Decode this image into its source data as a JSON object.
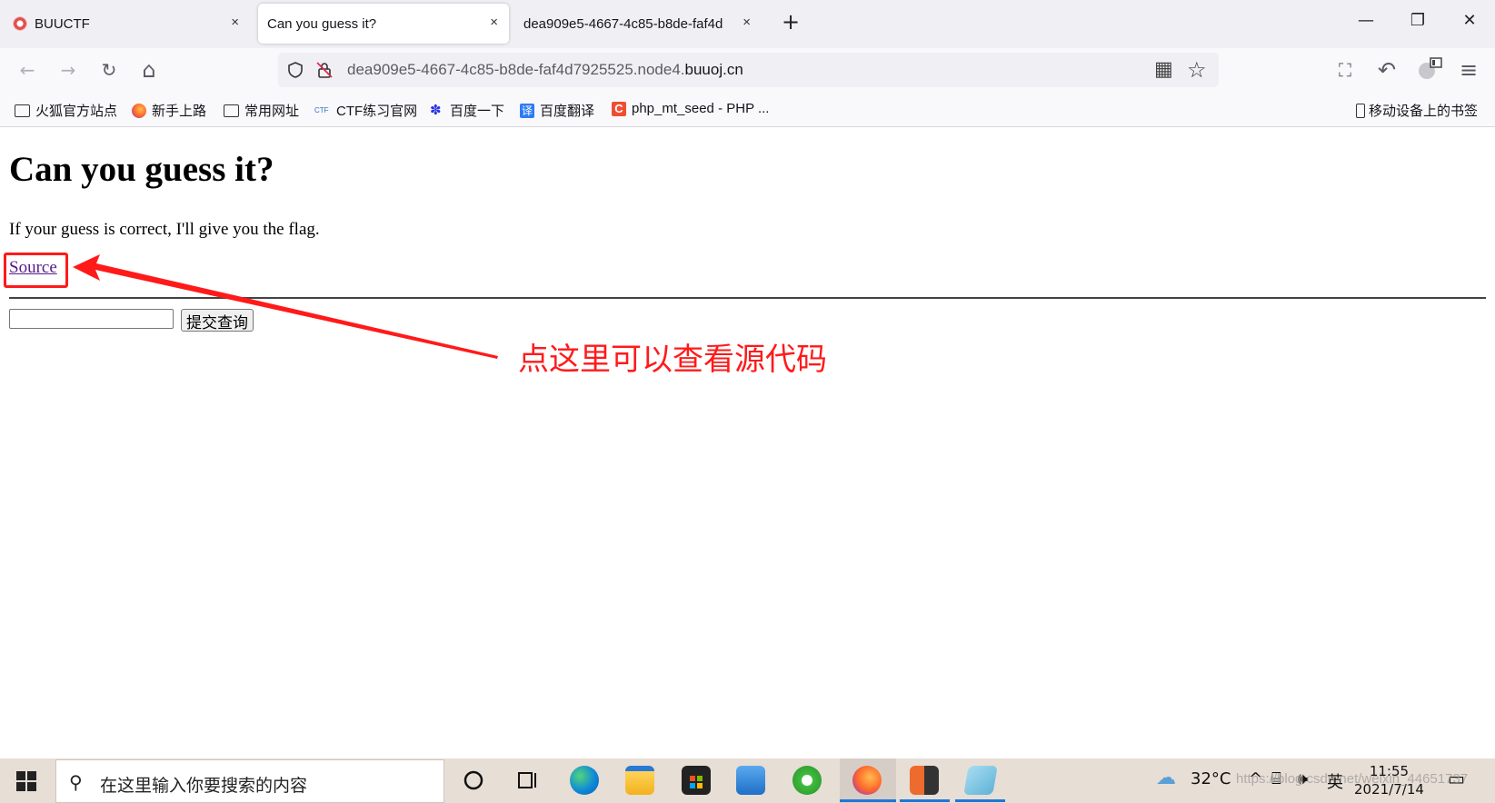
{
  "tabs": [
    {
      "title": "BUUCTF",
      "close": "×"
    },
    {
      "title": "Can you guess it?",
      "close": "×"
    },
    {
      "title": "dea909e5-4667-4c85-b8de-faf4d",
      "close": "×"
    }
  ],
  "tab_new": "+",
  "window": {
    "minimize": "—",
    "restore": "❐",
    "close": "✕"
  },
  "nav": {
    "back": "←",
    "forward": "→",
    "reload": "↻",
    "home": "⌂",
    "url_prefix": "dea909e5-4667-4c85-b8de-faf4d7925525.node4.",
    "url_domain": "buuoj.cn",
    "star": "☆",
    "qr": "▦",
    "crop": "⛶",
    "undo": "↶",
    "menu": "≡"
  },
  "bookmarks": [
    {
      "label": "火狐官方站点",
      "icon": "folder-icon"
    },
    {
      "label": "新手上路",
      "icon": "firefox-icon"
    },
    {
      "label": "常用网址",
      "icon": "folder-icon"
    },
    {
      "label": "CTF练习官网",
      "icon": "ctf-icon"
    },
    {
      "label": "百度一下",
      "icon": "baidu-paw-icon"
    },
    {
      "label": "百度翻译",
      "icon": "translate-icon"
    },
    {
      "label": "php_mt_seed - PHP ...",
      "icon": "c-icon"
    }
  ],
  "mobile_bookmarks": "移动设备上的书签",
  "page": {
    "heading": "Can you guess it?",
    "paragraph": "If your guess is correct, I'll give you the flag.",
    "source_link": "Source",
    "submit_label": "提交查询",
    "input_value": ""
  },
  "annotation": "点这里可以查看源代码",
  "taskbar": {
    "search_placeholder": "在这里输入你要搜索的内容",
    "weather_temp": "32°C",
    "ime": "英",
    "time": "11:55",
    "date": "2021/7/14",
    "watermark": "https://blog.csdn.net/weixin_44651737"
  },
  "colors": {
    "annotation_red": "#ff1a1a",
    "link_visited": "#551a8b",
    "taskbar_bg": "#e7ded5"
  }
}
